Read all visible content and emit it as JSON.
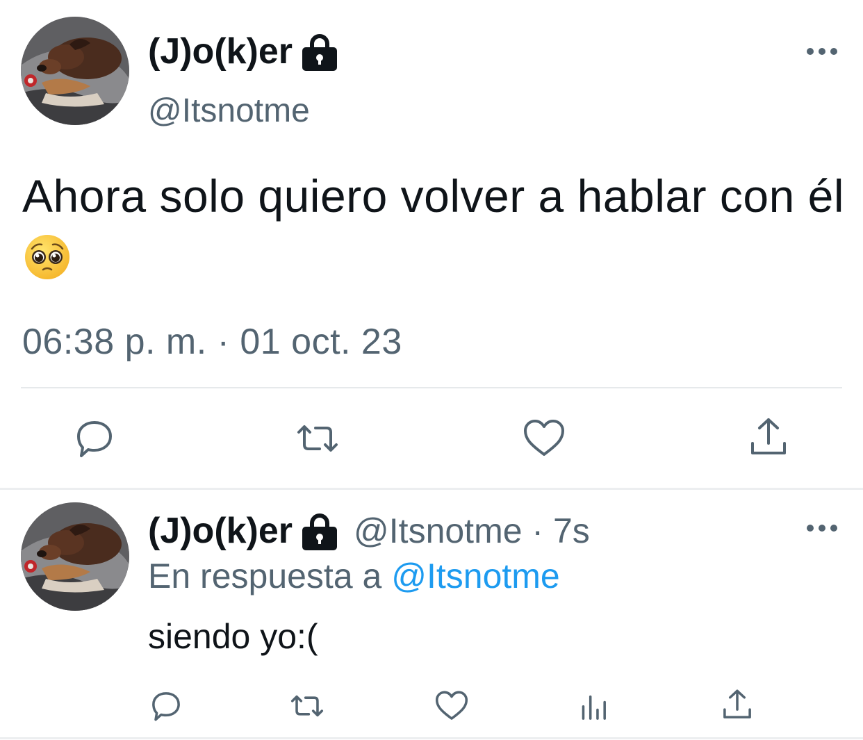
{
  "main_tweet": {
    "display_name": "(J)o(k)er",
    "handle": "@Itsnotme",
    "text": "Ahora solo quiero volver a hablar con él",
    "emoji": "pleading-face",
    "timestamp": "06:38 p. m. · 01 oct. 23",
    "actions": [
      "reply-icon",
      "retweet-icon",
      "like-icon",
      "share-icon"
    ]
  },
  "reply_tweet": {
    "display_name": "(J)o(k)er",
    "handle_time": "@Itsnotme · 7s",
    "reply_prefix": "En respuesta a",
    "reply_mention": "@Itsnotme",
    "text": "siendo yo:(",
    "actions": [
      "reply-icon",
      "retweet-icon",
      "like-icon",
      "views-icon",
      "share-icon"
    ]
  },
  "colors": {
    "text": "#0f1419",
    "secondary": "#536471",
    "accent": "#1d9bf0",
    "divider": "#e6e9eb"
  }
}
